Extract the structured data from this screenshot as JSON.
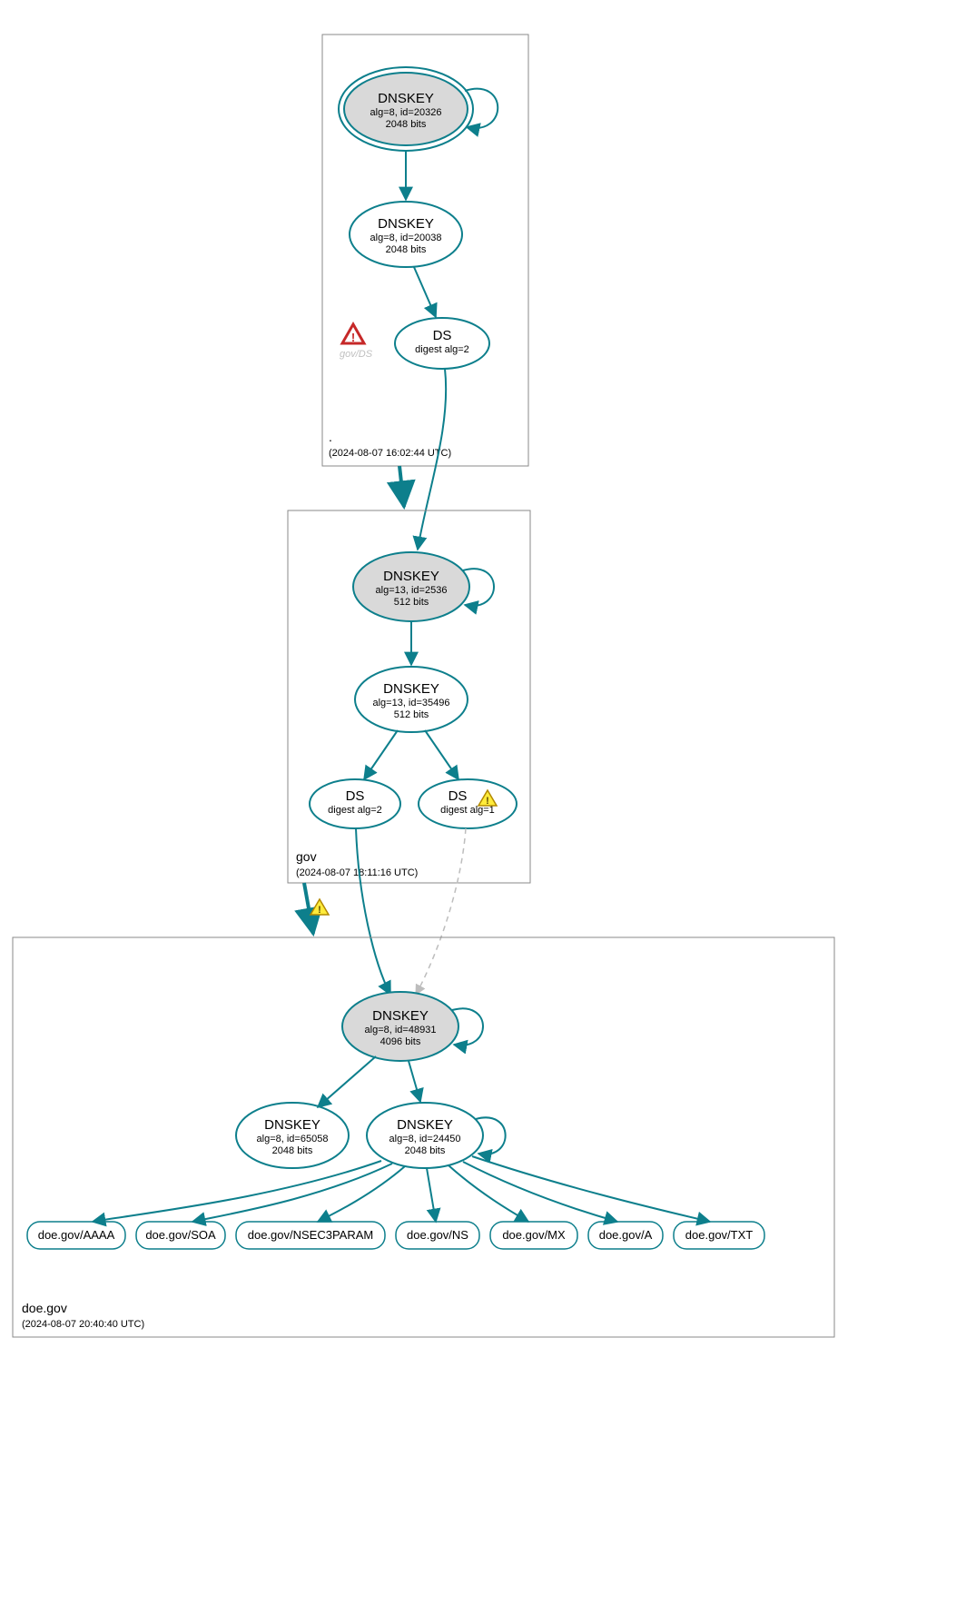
{
  "colors": {
    "accent": "#0d7f8c",
    "ksk_fill": "#d9d9d9",
    "warn_red_stroke": "#c62828",
    "warn_yellow_fill": "#ffeb3b",
    "warn_yellow_stroke": "#b28900"
  },
  "zones": {
    "root": {
      "name": ".",
      "timestamp": "(2024-08-07 16:02:44 UTC)",
      "ksk": {
        "title": "DNSKEY",
        "line1": "alg=8, id=20326",
        "line2": "2048 bits"
      },
      "zsk": {
        "title": "DNSKEY",
        "line1": "alg=8, id=20038",
        "line2": "2048 bits"
      },
      "ds": {
        "title": "DS",
        "line1": "digest alg=2"
      },
      "ghost_ds": "gov/DS"
    },
    "gov": {
      "name": "gov",
      "timestamp": "(2024-08-07 18:11:16 UTC)",
      "ksk": {
        "title": "DNSKEY",
        "line1": "alg=13, id=2536",
        "line2": "512 bits"
      },
      "zsk": {
        "title": "DNSKEY",
        "line1": "alg=13, id=35496",
        "line2": "512 bits"
      },
      "ds1": {
        "title": "DS",
        "line1": "digest alg=2"
      },
      "ds2": {
        "title": "DS",
        "line1": "digest alg=1"
      }
    },
    "doe": {
      "name": "doe.gov",
      "timestamp": "(2024-08-07 20:40:40 UTC)",
      "ksk": {
        "title": "DNSKEY",
        "line1": "alg=8, id=48931",
        "line2": "4096 bits"
      },
      "zsk1": {
        "title": "DNSKEY",
        "line1": "alg=8, id=65058",
        "line2": "2048 bits"
      },
      "zsk2": {
        "title": "DNSKEY",
        "line1": "alg=8, id=24450",
        "line2": "2048 bits"
      },
      "rrsets": [
        "doe.gov/AAAA",
        "doe.gov/SOA",
        "doe.gov/NSEC3PARAM",
        "doe.gov/NS",
        "doe.gov/MX",
        "doe.gov/A",
        "doe.gov/TXT"
      ]
    }
  }
}
